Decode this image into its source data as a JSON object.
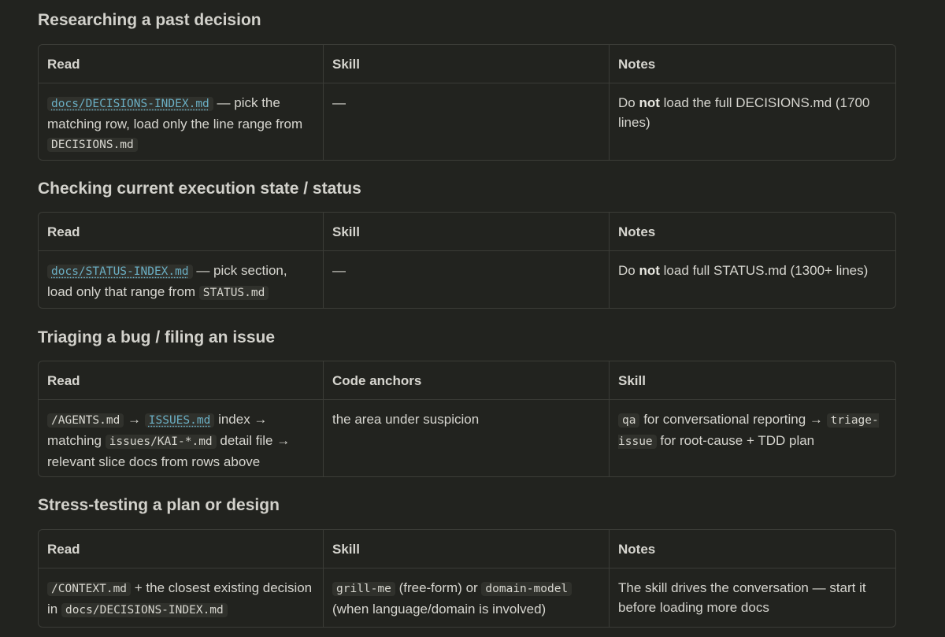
{
  "sections": [
    {
      "title": "Researching a past decision",
      "headers": [
        "Read",
        "Skill",
        "Notes"
      ],
      "read": {
        "link": "docs/DECISIONS-INDEX.md",
        "text1": " — pick the matching row, load only the line range from ",
        "code1": "DECISIONS.md"
      },
      "col2": "—",
      "notes": {
        "pre": "Do ",
        "bold": "not",
        "post": " load the full DECISIONS.md (1700 lines)"
      }
    },
    {
      "title": "Checking current execution state / status",
      "headers": [
        "Read",
        "Skill",
        "Notes"
      ],
      "read": {
        "link": "docs/STATUS-INDEX.md",
        "text1": " — pick section, load only that range from ",
        "code1": "STATUS.md"
      },
      "col2": "—",
      "notes": {
        "pre": "Do ",
        "bold": "not",
        "post": " load full STATUS.md (1300+ lines)"
      }
    },
    {
      "title": "Triaging a bug / filing an issue",
      "headers": [
        "Read",
        "Code anchors",
        "Skill"
      ],
      "read": {
        "code1": "/AGENTS.md",
        "text1": " → ",
        "link": "ISSUES.md",
        "text2": " index → matching ",
        "code2": "issues/KAI-*.md",
        "text3": " detail file → relevant slice docs from rows above"
      },
      "col2": "the area under suspicion",
      "skill": {
        "code1": "qa",
        "text1": " for conversational reporting → ",
        "code2": "triage-issue",
        "text2": " for root-cause + TDD plan"
      }
    },
    {
      "title": "Stress-testing a plan or design",
      "headers": [
        "Read",
        "Skill",
        "Notes"
      ],
      "read": {
        "code1": "/CONTEXT.md",
        "text1": " + the closest existing decision in ",
        "code2": "docs/DECISIONS-INDEX.md"
      },
      "skill": {
        "code1": "grill-me",
        "text1": " (free-form) or ",
        "code2": "domain-model",
        "text2": " (when language/domain is involved)"
      },
      "notes": "The skill drives the conversation — start it before loading more docs"
    }
  ]
}
